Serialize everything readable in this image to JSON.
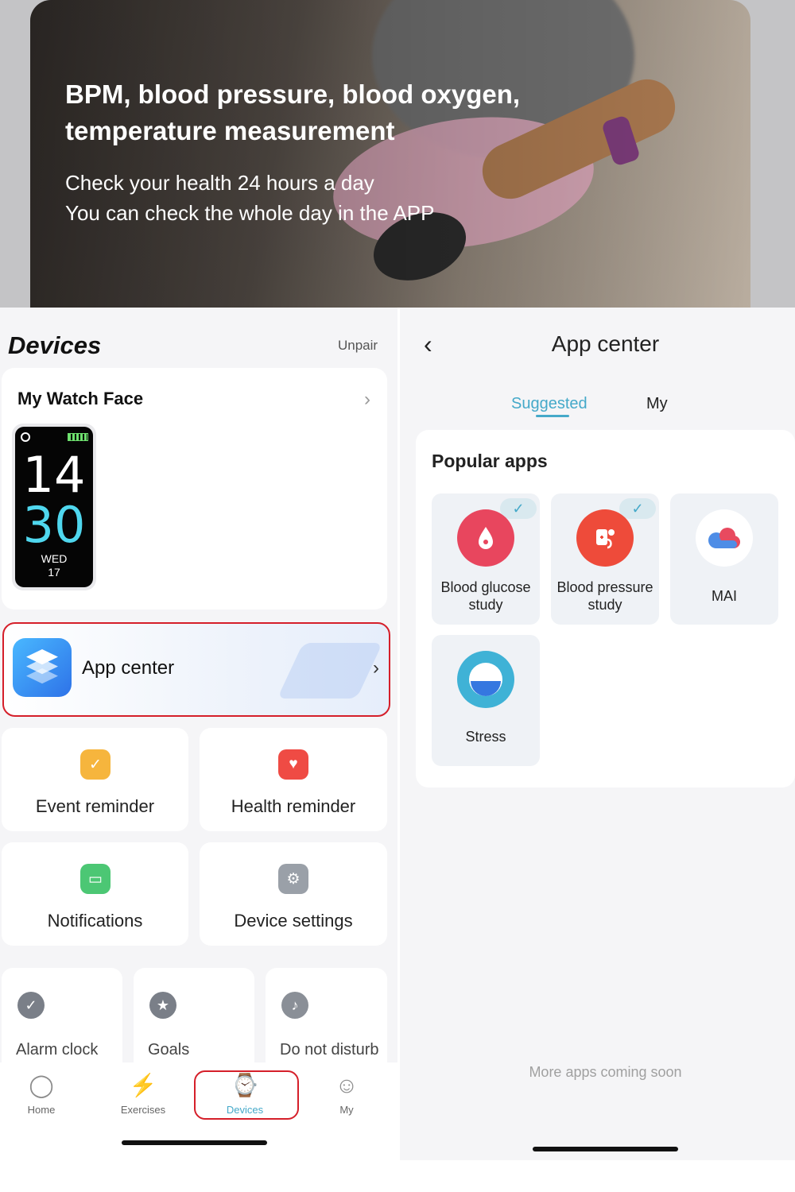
{
  "banner": {
    "headline": "BPM, blood pressure, blood oxygen, temperature measurement",
    "line1": "Check your health 24 hours a day",
    "line2": "You can check the whole day in the APP"
  },
  "devices": {
    "title": "Devices",
    "unpair_label": "Unpair",
    "watch_face": {
      "title": "My Watch Face",
      "hour": "14",
      "minute": "30",
      "weekday": "WED",
      "date": "17"
    },
    "app_center": {
      "label": "App center"
    },
    "tiles": [
      {
        "label": "Event reminder",
        "icon": "calendar-check-icon",
        "color": "#f6b53d"
      },
      {
        "label": "Health reminder",
        "icon": "heart-bell-icon",
        "color": "#ef4b44"
      },
      {
        "label": "Notifications",
        "icon": "message-icon",
        "color": "#4cc774"
      },
      {
        "label": "Device settings",
        "icon": "gear-icon",
        "color": "#9aa0a8"
      }
    ],
    "small_tiles": [
      {
        "label": "Alarm clock",
        "icon": "alarm-icon"
      },
      {
        "label": "Goals",
        "icon": "star-medal-icon"
      },
      {
        "label": "Do not disturb",
        "icon": "bell-mute-icon"
      }
    ]
  },
  "tabbar": {
    "items": [
      {
        "label": "Home",
        "icon": "home-icon",
        "active": false
      },
      {
        "label": "Exercises",
        "icon": "runner-icon",
        "active": false
      },
      {
        "label": "Devices",
        "icon": "watch-icon",
        "active": true
      },
      {
        "label": "My",
        "icon": "person-icon",
        "active": false
      }
    ]
  },
  "app_center": {
    "title": "App center",
    "tabs": {
      "suggested": "Suggested",
      "my": "My"
    },
    "section_title": "Popular apps",
    "apps": [
      {
        "name": "Blood glucose study",
        "icon": "blood-drop-icon",
        "color": "#e8465e",
        "installed": true
      },
      {
        "name": "Blood pressure study",
        "icon": "blood-pressure-icon",
        "color": "#ee4b3a",
        "installed": true
      },
      {
        "name": "MAI",
        "icon": "mai-cloud-icon",
        "color": "#ffffff",
        "installed": false
      },
      {
        "name": "Stress",
        "icon": "stress-icon",
        "color": "#3fb2d6",
        "installed": false
      }
    ],
    "footer": "More apps coming soon"
  }
}
